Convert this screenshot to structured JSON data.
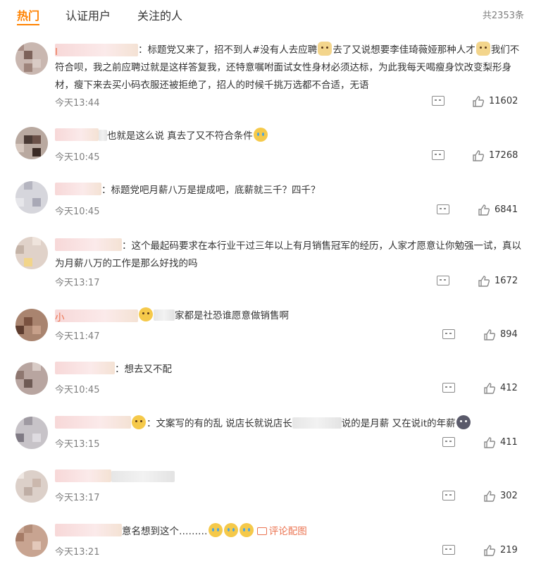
{
  "tabs": [
    {
      "label": "热门",
      "active": true
    },
    {
      "label": "认证用户",
      "active": false
    },
    {
      "label": "关注的人",
      "active": false
    }
  ],
  "total": "共2353条",
  "accent": "#ff8200",
  "comments": [
    {
      "name_hint": "I",
      "text1": "：标题党又来了，招不到人#没有人去应聘",
      "text2": "去了又说想要李佳琦薇娅那种人才",
      "text3": "我们不符合呗，我之前应聘过就是这样答复我，还特意嘱咐面试女性身材必须达标，为此我每天喝瘦身饮改变梨形身材，瘦下来去买小码衣服还被拒绝了，招人的时候千挑万选都不合适，无语",
      "time": "今天13:44",
      "likes": "11602"
    },
    {
      "text1": "也就是这么说 真去了又不符合条件",
      "time": "今天10:45",
      "likes": "17268"
    },
    {
      "text1": "：标题党吧月薪八万是提成吧，底薪就三千？四千？",
      "time": "今天10:45",
      "likes": "6841"
    },
    {
      "text1": "：这个最起码要求在本行业干过三年以上有月销售冠军的经历，人家才愿意让你勉强一试，真以为月薪八万的工作是那么好找的吗",
      "time": "今天13:17",
      "likes": "1672"
    },
    {
      "name_hint": "小",
      "text1": "家都是社恐谁愿意做销售啊",
      "time": "今天11:47",
      "likes": "894"
    },
    {
      "text1": "：想去又不配",
      "time": "今天10:45",
      "likes": "412"
    },
    {
      "text1": "：文案写的有的乱 说店长就说店长",
      "text2": "说的是月薪 又在说it的年薪",
      "time": "今天13:15",
      "likes": "411"
    },
    {
      "time": "今天13:17",
      "likes": "302"
    },
    {
      "text1": "意名想到这个………",
      "link": "评论配图",
      "time": "今天13:21",
      "likes": "219"
    }
  ]
}
